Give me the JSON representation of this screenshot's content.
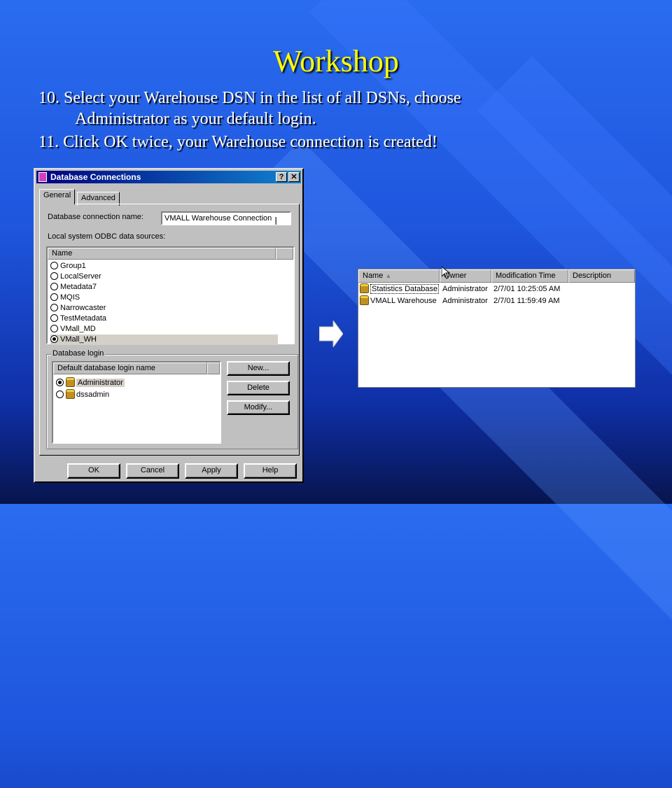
{
  "slide": {
    "title": "Workshop",
    "step10_line1": "10. Select your Warehouse DSN  in the list of all DSNs, choose",
    "step10_line2": "Administrator as your default login.",
    "step11": "11. Click OK twice, your Warehouse connection is created!"
  },
  "dialog": {
    "title": "Database Connections",
    "help_btn": "?",
    "close_btn": "✕",
    "tabs": [
      "General",
      "Advanced"
    ],
    "conn_name_label": "Database connection name:",
    "conn_name_value": "VMALL Warehouse Connection",
    "odbc_label": "Local system ODBC data sources:",
    "dsn_col": "Name",
    "dsns": [
      "Group1",
      "LocalServer",
      "Metadata7",
      "MQIS",
      "Narrowcaster",
      "TestMetadata",
      "VMall_MD",
      "VMall_WH"
    ],
    "dsn_selected": "VMall_WH",
    "login_group": "Database login",
    "login_col": "Default database login name",
    "logins": [
      "Administrator",
      "dssadmin"
    ],
    "login_selected": "Administrator",
    "btn_new": "New...",
    "btn_delete": "Delete",
    "btn_modify": "Modify...",
    "btn_ok": "OK",
    "btn_cancel": "Cancel",
    "btn_apply": "Apply",
    "btn_help": "Help"
  },
  "results": {
    "columns": [
      "Name",
      "Owner",
      "Modification Time",
      "Description"
    ],
    "rows": [
      {
        "name": "Statistics Database",
        "owner": "Administrator",
        "time": "2/7/01 10:25:05 AM",
        "desc": ""
      },
      {
        "name": "VMALL Warehouse",
        "owner": "Administrator",
        "time": "2/7/01 11:59:49 AM",
        "desc": ""
      }
    ]
  },
  "icons": {
    "arrow": "right-arrow-icon",
    "database": "database-icon",
    "radio": "radio-icon",
    "cursor": "mouse-cursor-icon",
    "ibeam": "text-cursor-icon",
    "sort": "sort-arrow-icon"
  }
}
